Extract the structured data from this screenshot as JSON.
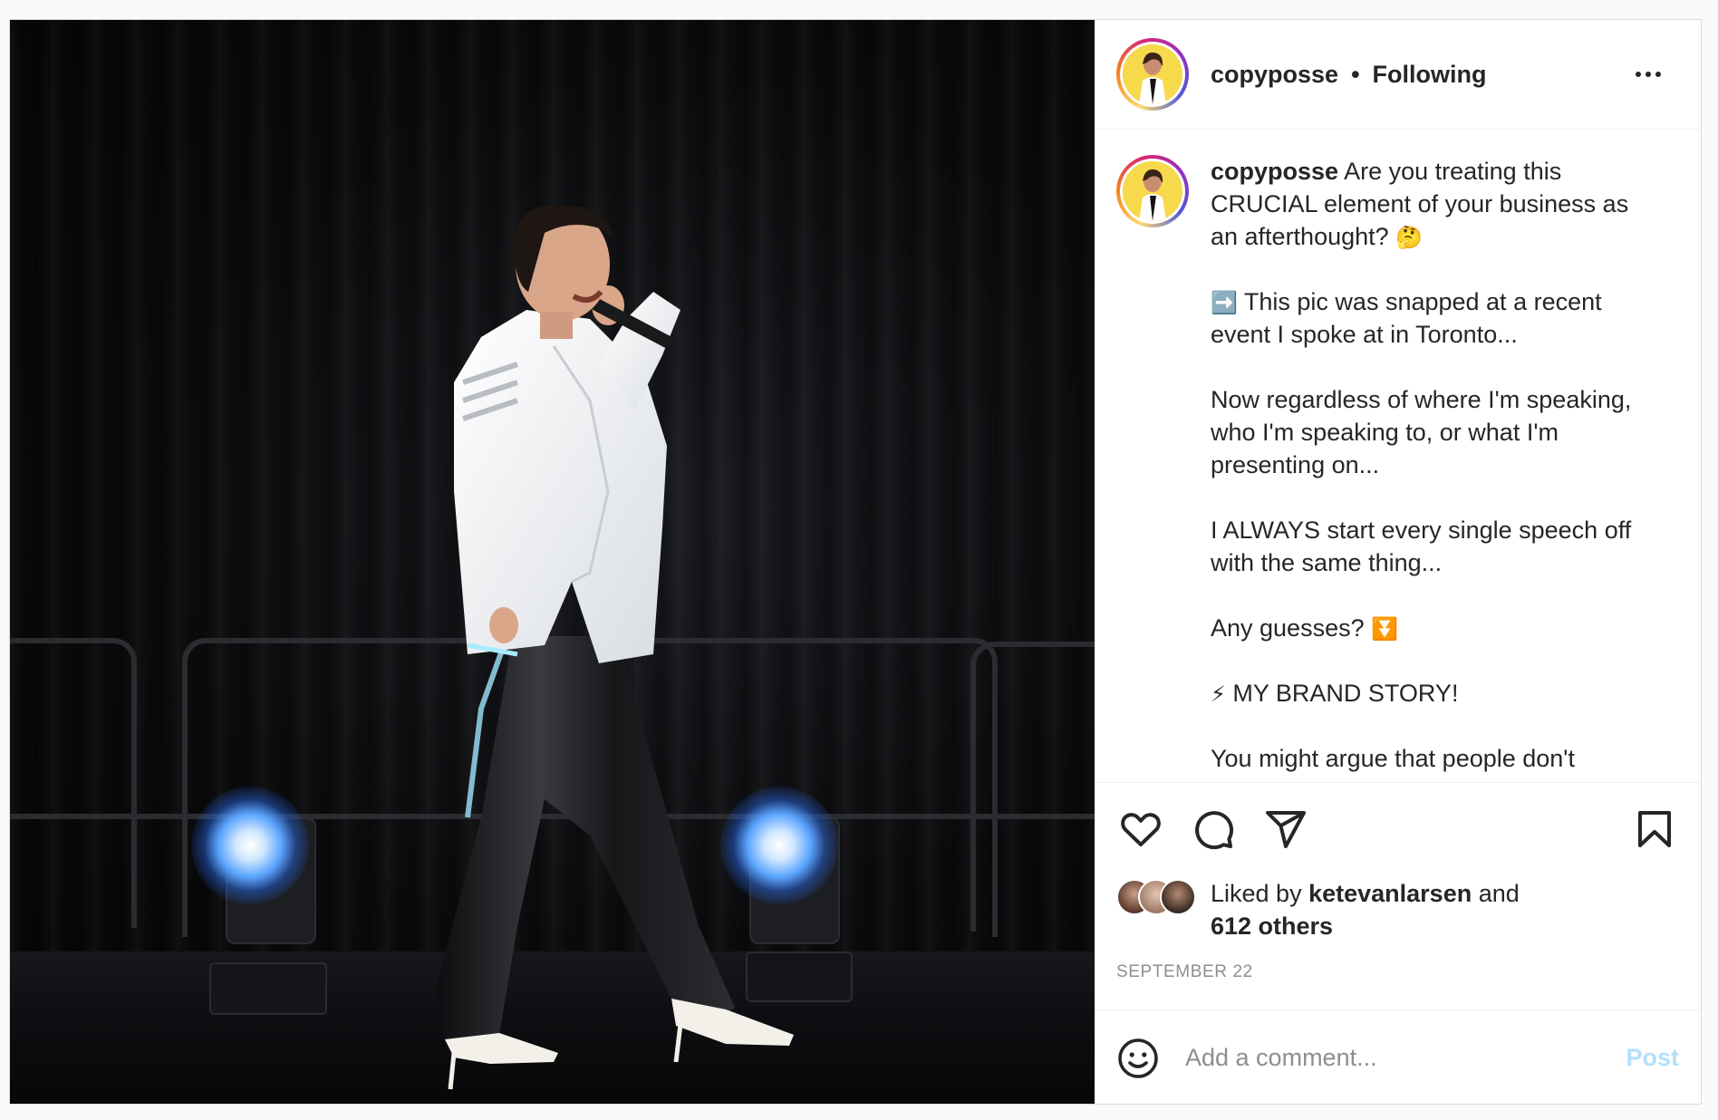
{
  "post": {
    "username": "copyposse",
    "separator": "•",
    "follow_status": "Following",
    "more_icon": "more-horizontal-icon"
  },
  "caption": {
    "username": "copyposse",
    "line1": "Are you treating this CRUCIAL element of your business as an afterthought?",
    "line1_emoji": "🤔",
    "p2_emoji": "➡️",
    "p2": "This pic was snapped at a recent event I spoke at in Toronto...",
    "p3": "Now regardless of where I'm speaking, who I'm speaking to, or what I'm presenting on...",
    "p4": "I ALWAYS start every single speech off with the same thing...",
    "p5": "Any guesses?",
    "p5_emoji": "⏬",
    "p6_emoji": "⚡",
    "p6": "MY BRAND STORY!",
    "p7": "You might argue that people don't"
  },
  "actions": {
    "like_icon": "heart-icon",
    "comment_icon": "comment-icon",
    "share_icon": "share-icon",
    "save_icon": "bookmark-icon"
  },
  "likes": {
    "prefix": "Liked by",
    "user": "ketevanlarsen",
    "and": "and",
    "others": "612 others"
  },
  "date": "SEPTEMBER 22",
  "comment": {
    "placeholder": "Add a comment...",
    "post_label": "Post",
    "emoji_icon": "smiley-icon"
  },
  "colors": {
    "text": "#262626",
    "muted": "#8e8e8e",
    "post_disabled": "#b2dffc",
    "border": "#dbdbdb"
  }
}
